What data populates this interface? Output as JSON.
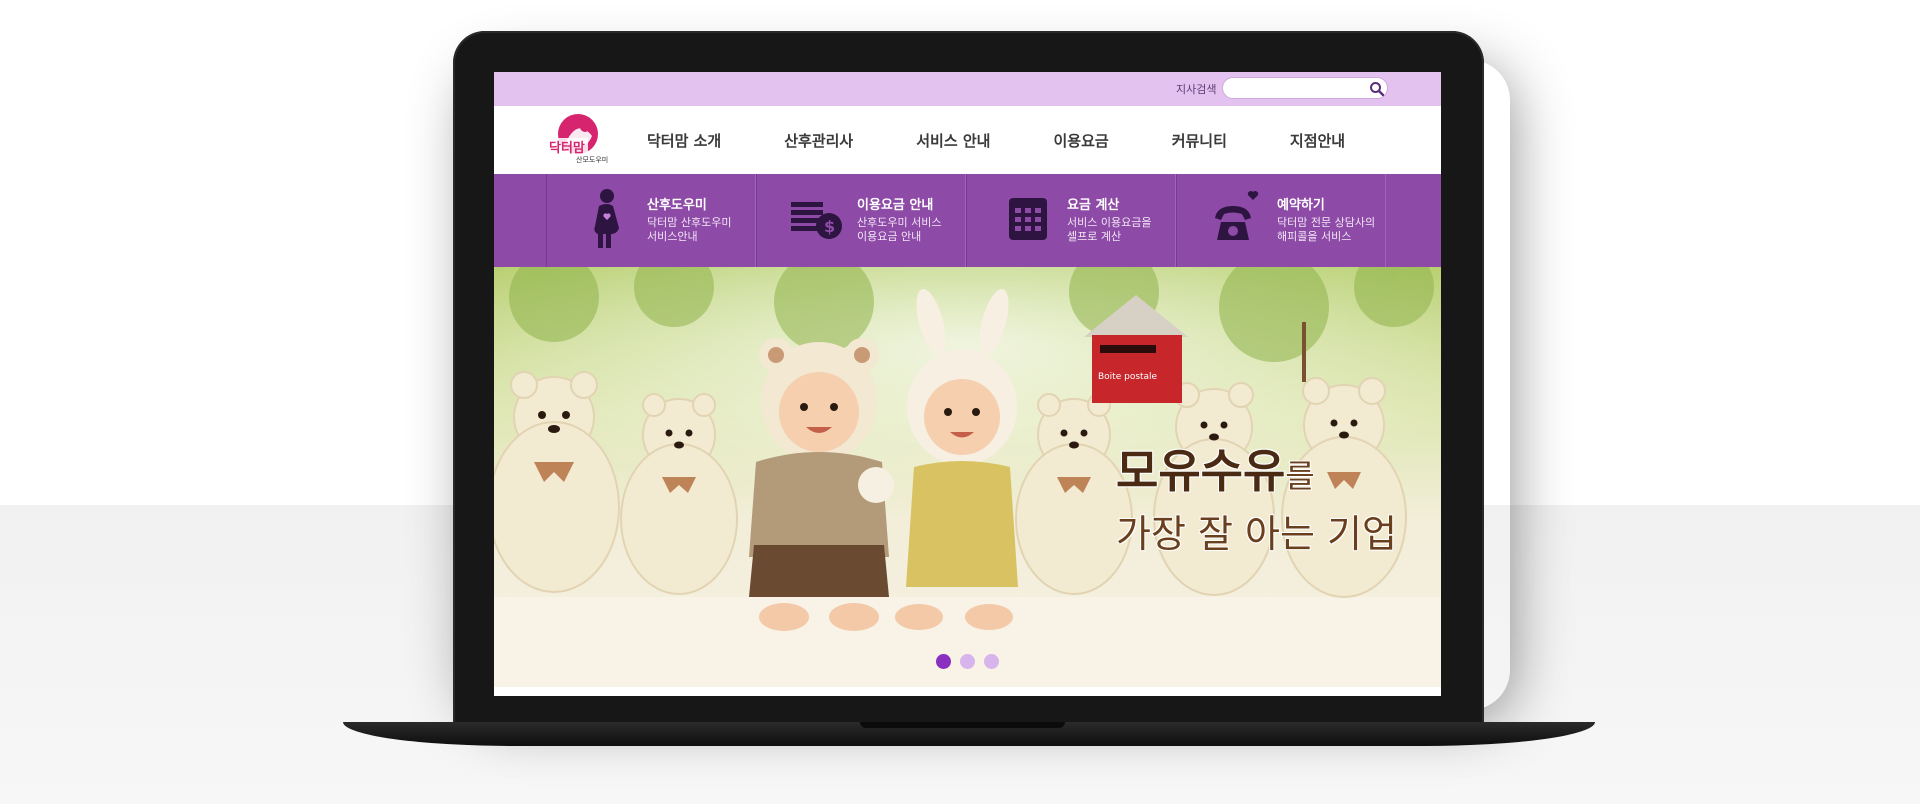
{
  "topbar": {
    "search_label": "지사검색",
    "search_placeholder": ""
  },
  "logo": {
    "text_main": "닥터맘",
    "text_sub": "산모도우미"
  },
  "nav": {
    "items": [
      "닥터맘 소개",
      "산후관리사",
      "서비스 안내",
      "이용요금",
      "커뮤니티",
      "지점안내"
    ]
  },
  "quick_menu": {
    "items": [
      {
        "title": "산후도우미",
        "desc_line1": "닥터맘 산후도우미",
        "desc_line2": "서비스안내",
        "icon": "pregnant-woman-icon"
      },
      {
        "title": "이용요금 안내",
        "desc_line1": "산후도우미 서비스",
        "desc_line2": "이용요금 안내",
        "icon": "money-stack-icon"
      },
      {
        "title": "요금 계산",
        "desc_line1": "서비스 이용요금을",
        "desc_line2": "셀프로 계산",
        "icon": "calculator-icon"
      },
      {
        "title": "예약하기",
        "desc_line1": "닥터맘 전문 상담사의",
        "desc_line2": "해피콜을 서비스",
        "icon": "phone-heart-icon"
      }
    ]
  },
  "hero": {
    "line1_bold": "모유수유",
    "line1_rest": "를",
    "line2": "가장 잘 아는 기업",
    "mailbox_text": "Boite postale",
    "slides_total": 3,
    "slide_active": 1
  },
  "colors": {
    "topbar": "#e4c2ef",
    "quickbar": "#8d4aa6",
    "logo_pink": "#d6246e",
    "dot_active": "#8b2fc0",
    "dot_inactive": "#d7b5ec"
  }
}
